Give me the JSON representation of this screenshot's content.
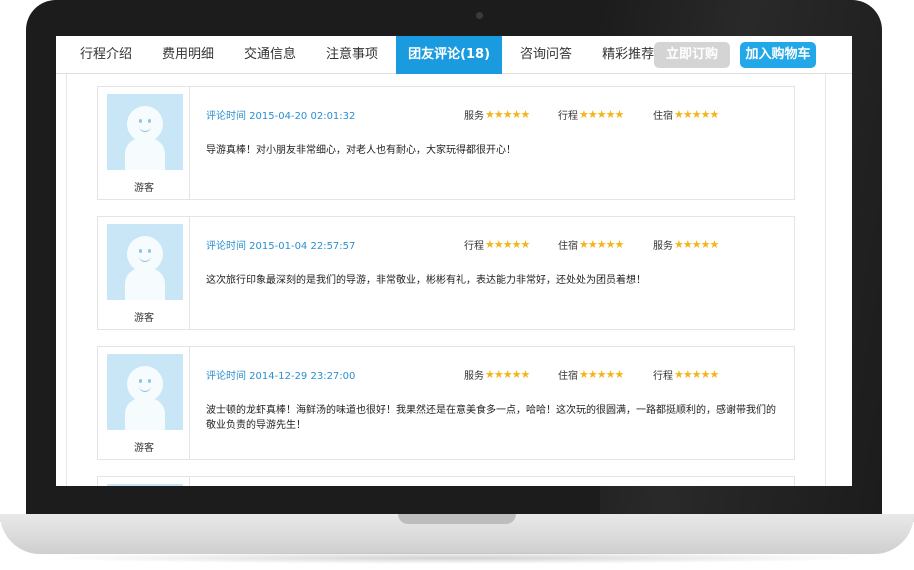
{
  "tabs": [
    {
      "label": "行程介绍",
      "active": false
    },
    {
      "label": "费用明细",
      "active": false
    },
    {
      "label": "交通信息",
      "active": false
    },
    {
      "label": "注意事项",
      "active": false
    },
    {
      "label": "团友评论(18)",
      "active": true
    },
    {
      "label": "咨询问答",
      "active": false
    },
    {
      "label": "精彩推荐",
      "active": false
    }
  ],
  "buttons": {
    "buy": "立即订购",
    "cart": "加入购物车"
  },
  "colors": {
    "accent": "#1a9be0",
    "cart": "#22a7e8",
    "buy_disabled": "#d4d4d4",
    "star": "#f3b51b",
    "time": "#2b8fd1"
  },
  "reviews": [
    {
      "user": "游客",
      "time": "评论时间 2015-04-20 02:01:32",
      "ratings": [
        {
          "label": "服务",
          "stars": 5
        },
        {
          "label": "行程",
          "stars": 5
        },
        {
          "label": "住宿",
          "stars": 5
        }
      ],
      "text": "导游真棒！对小朋友非常细心，对老人也有耐心，大家玩得都很开心！"
    },
    {
      "user": "游客",
      "time": "评论时间 2015-01-04 22:57:57",
      "ratings": [
        {
          "label": "行程",
          "stars": 5
        },
        {
          "label": "住宿",
          "stars": 5
        },
        {
          "label": "服务",
          "stars": 5
        }
      ],
      "text": "这次旅行印象最深刻的是我们的导游，非常敬业，彬彬有礼，表达能力非常好，还处处为团员着想！"
    },
    {
      "user": "游客",
      "time": "评论时间 2014-12-29 23:27:00",
      "ratings": [
        {
          "label": "服务",
          "stars": 5
        },
        {
          "label": "住宿",
          "stars": 5
        },
        {
          "label": "行程",
          "stars": 5
        }
      ],
      "text": "波士顿的龙虾真棒！海鲜汤的味道也很好！我果然还是在意美食多一点，哈哈！这次玩的很圆满，一路都挺顺利的，感谢带我们的敬业负责的导游先生！"
    }
  ]
}
